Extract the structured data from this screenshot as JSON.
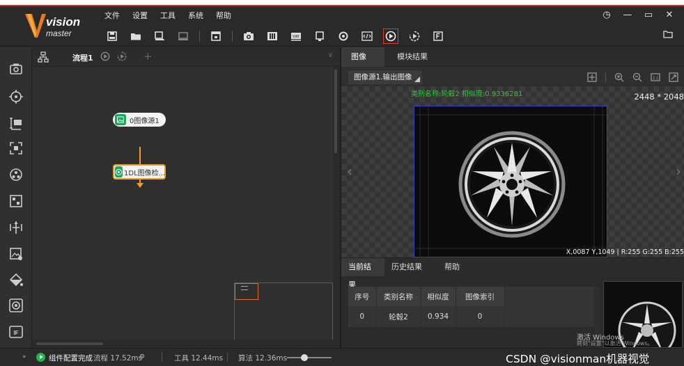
{
  "app": {
    "logo_primary": "vision",
    "logo_secondary": "master"
  },
  "menu": [
    "文件",
    "设置",
    "工具",
    "系统",
    "帮助"
  ],
  "window_controls": [
    "◷",
    "—",
    "▭",
    "✕"
  ],
  "flow": {
    "tab_label": "流程1",
    "add_symbol": "+",
    "nodes": [
      {
        "label": "0图像源1"
      },
      {
        "label": "1DL图像检..."
      }
    ]
  },
  "image_panel": {
    "tabs": [
      "图像",
      "模块结果"
    ],
    "active_tab": 0,
    "source_select": "图像源1.输出图像",
    "result_overlay": "类别名称:轮毂2 相似度:0.9336281",
    "dimensions": "2448 * 2048",
    "pixel_info": "X,0087 Y,1049 | R:255 G:255 B:255",
    "nav_prev": "‹",
    "nav_next": "›"
  },
  "results": {
    "tabs": [
      "当前结果",
      "历史结果",
      "帮助"
    ],
    "active_tab": 0,
    "columns": [
      "序号",
      "类别名称",
      "相似度",
      "图像索引"
    ],
    "rows": [
      [
        "0",
        "轮毂2",
        "0.934",
        "0"
      ]
    ]
  },
  "watermark": {
    "line1": "激活 Windows",
    "line2": "转到\"设置\"以激活 Windows。"
  },
  "status": {
    "expand": "»",
    "state": "组件配置完成",
    "flow_time": "流程 17.52ms",
    "tool_time": "工具 12.44ms",
    "algo_time": "算法 12.36ms",
    "credit": "CSDN @visionman机器视觉"
  },
  "colors": {
    "accent_red": "#c4372f",
    "node_green": "#1aa85c",
    "connector_orange": "#f0a020",
    "overlay_green": "#36c13a"
  }
}
